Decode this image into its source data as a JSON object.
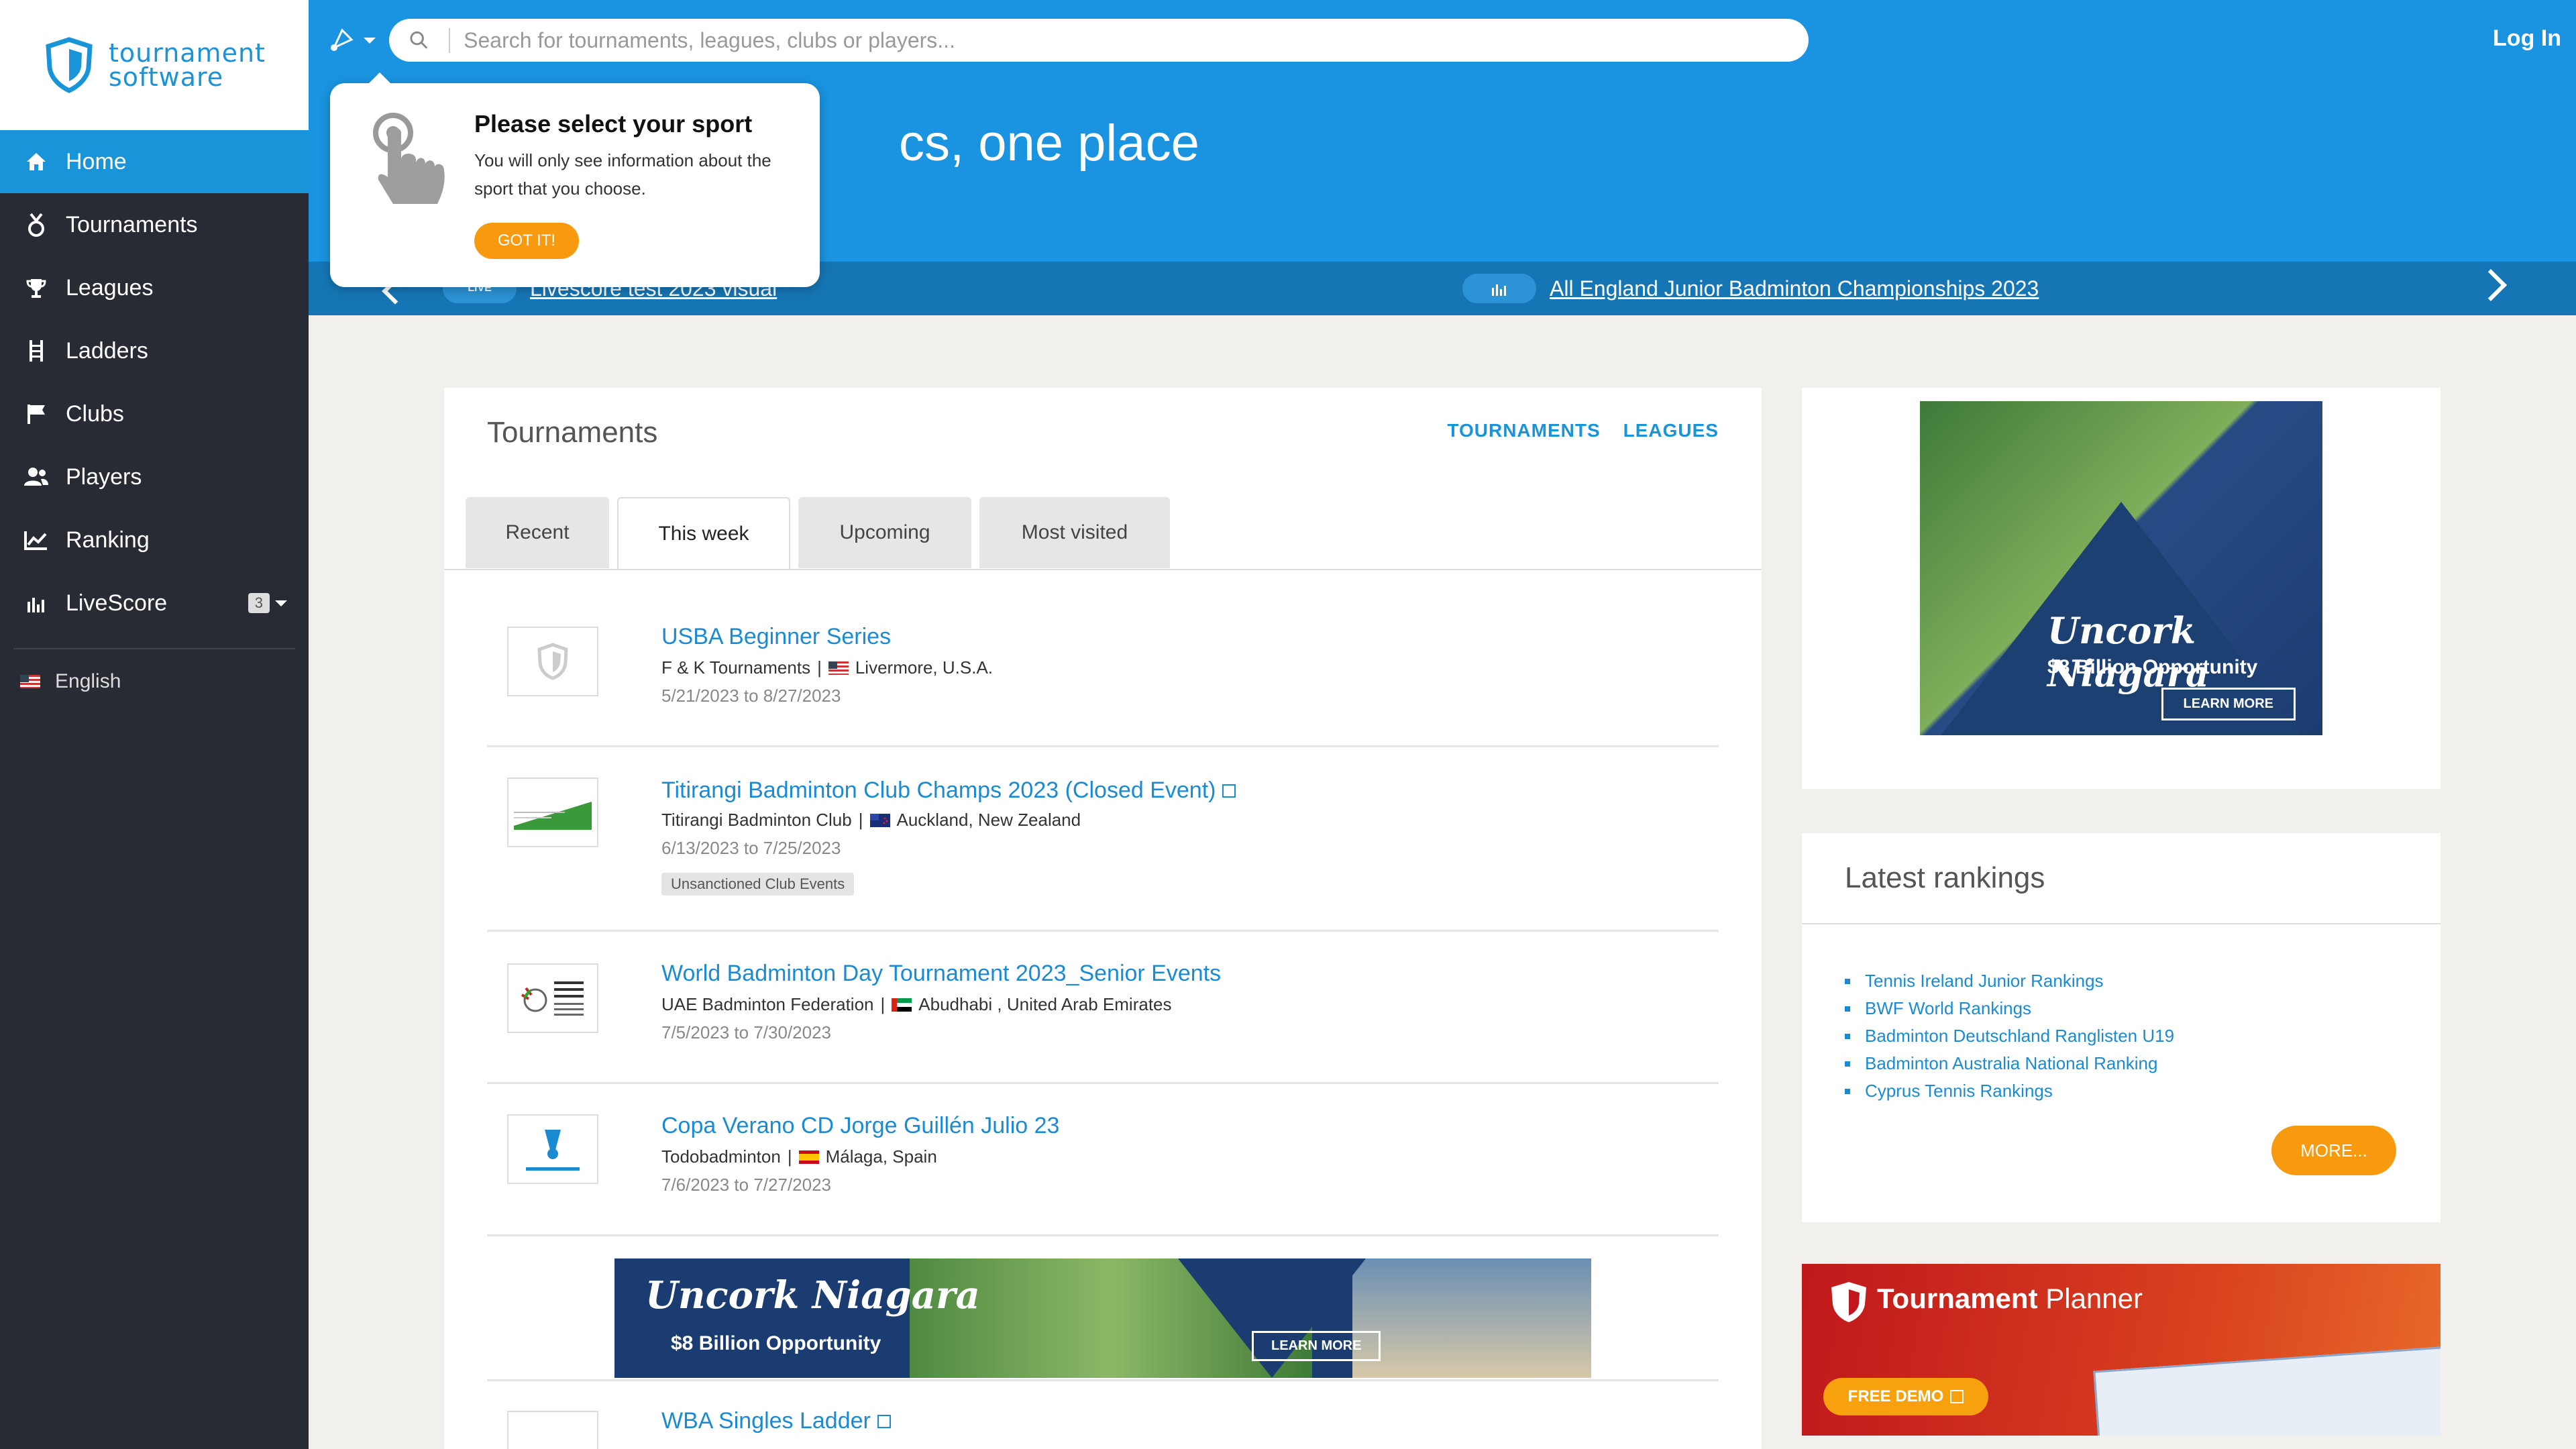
{
  "app": {
    "logo_line1": "tournament",
    "logo_line2": "software",
    "login": "Log In"
  },
  "colors": {
    "brand": "#1a94e0",
    "sidebar": "#282b33",
    "accent_orange": "#f79a0f"
  },
  "sidebar": {
    "items": [
      {
        "label": "Home",
        "icon": "home-icon"
      },
      {
        "label": "Tournaments",
        "icon": "medal-icon"
      },
      {
        "label": "Leagues",
        "icon": "trophy-icon"
      },
      {
        "label": "Ladders",
        "icon": "ladder-icon"
      },
      {
        "label": "Clubs",
        "icon": "flag-icon"
      },
      {
        "label": "Players",
        "icon": "users-icon"
      },
      {
        "label": "Ranking",
        "icon": "chart-icon"
      },
      {
        "label": "LiveScore",
        "icon": "live-icon",
        "badge": "3"
      }
    ],
    "language": "English"
  },
  "search": {
    "placeholder": "Search for tournaments, leagues, clubs or players..."
  },
  "hero": {
    "title_visible": "cs, one place"
  },
  "ticker": {
    "item1": "Livescore test 2023 visual",
    "item2": "All England Junior Badminton Championships 2023",
    "live_label": "LIVE"
  },
  "popover": {
    "title": "Please select your sport",
    "text": "You will only see information about the sport that you choose.",
    "button": "GOT IT!"
  },
  "tournaments": {
    "title": "Tournaments",
    "link_tournaments": "TOURNAMENTS",
    "link_leagues": "LEAGUES",
    "tabs": [
      "Recent",
      "This week",
      "Upcoming",
      "Most visited"
    ],
    "active_tab": "This week",
    "rows": [
      {
        "name": "USBA Beginner Series",
        "org": "F & K Tournaments",
        "location": "Livermore, U.S.A.",
        "dates": "5/21/2023 to 8/27/2023"
      },
      {
        "name": "Titirangi Badminton Club Champs 2023 (Closed Event)",
        "org": "Titirangi Badminton Club",
        "location": "Auckland, New Zealand",
        "dates": "6/13/2023 to 7/25/2023",
        "tag": "Unsanctioned Club Events"
      },
      {
        "name": "World Badminton Day Tournament 2023_Senior Events",
        "org": "UAE Badminton Federation",
        "location": "Abudhabi , United Arab Emirates",
        "dates": "7/5/2023 to 7/30/2023"
      },
      {
        "name": "Copa Verano CD Jorge Guillén Julio 23",
        "org": "Todobadminton",
        "location": "Málaga, Spain",
        "dates": "7/6/2023 to 7/27/2023"
      },
      {
        "name": "WBA Singles Ladder"
      }
    ],
    "separator": "|"
  },
  "ad": {
    "headline": "Uncork Niagara",
    "sub": "$8 Billion Opportunity",
    "cta": "LEARN MORE"
  },
  "rankings": {
    "title": "Latest rankings",
    "items": [
      "Tennis Ireland Junior Rankings",
      "BWF World Rankings",
      "Badminton Deutschland Ranglisten U19",
      "Badminton Australia National Ranking",
      "Cyprus Tennis Rankings"
    ],
    "more": "MORE..."
  },
  "planner": {
    "title_bold": "Tournament",
    "title_light": " Planner",
    "button": "FREE DEMO"
  }
}
